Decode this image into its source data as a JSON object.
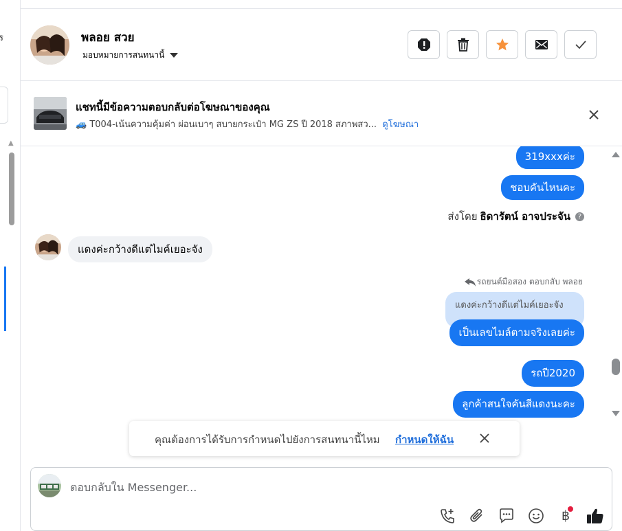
{
  "left_panel": {
    "fragment": "ร"
  },
  "header": {
    "contact_name": "พลอย สวย",
    "assign_label": "มอบหมายการสนทนานี้",
    "actions": [
      {
        "name": "spam-button",
        "icon": "alert-icon"
      },
      {
        "name": "delete-button",
        "icon": "trash-icon"
      },
      {
        "name": "star-button",
        "icon": "star-icon",
        "color": "#f7923b"
      },
      {
        "name": "mark-unread-button",
        "icon": "envelope-icon"
      },
      {
        "name": "done-button",
        "icon": "check-icon"
      }
    ]
  },
  "ad_banner": {
    "title": "แชทนี้มีข้อความตอบกลับต่อโฆษณาของคุณ",
    "emoji": "🚙",
    "description": "T004-เน้นความคุ้มค่า ผ่อนเบาๆ สบายกระเป๋า MG ZS ปี 2018 สภาพสว...",
    "link": "ดูโฆษณา"
  },
  "messages": {
    "out_1": "319xxxค่ะ",
    "out_2": "ชอบคันไหนคะ",
    "sent_by_prefix": "ส่งโดย",
    "sent_by_name": "ธิดารัตน์ อาจประจัน",
    "help_glyph": "?",
    "in_1": "แดงค่ะกว้างดีแต่ไมค์เยอะจัง",
    "reply_meta": "รถยนต์มือสอง ตอบกลับ พลอย",
    "quoted": "แดงค่ะกว้างดีแต่ไมค์เยอะจัง",
    "out_3": "เป็นเลขไมล์ตามจริงเลยค่ะ",
    "out_4": "รถปี2020",
    "out_5": "ลูกค้าสนใจคันสีแดงนะคะ"
  },
  "toast": {
    "text": "คุณต้องการได้รับการกำหนดไปยังการสนทนานี้ไหม",
    "link": "กำหนดให้ฉัน"
  },
  "composer": {
    "placeholder": "ตอบกลับใน Messenger...",
    "currency_glyph": "฿"
  },
  "colors": {
    "accent": "#1877f2",
    "link": "#216fdb",
    "incoming_bubble": "#f0f2f5",
    "quoted_bubble": "#cfe2fb"
  }
}
